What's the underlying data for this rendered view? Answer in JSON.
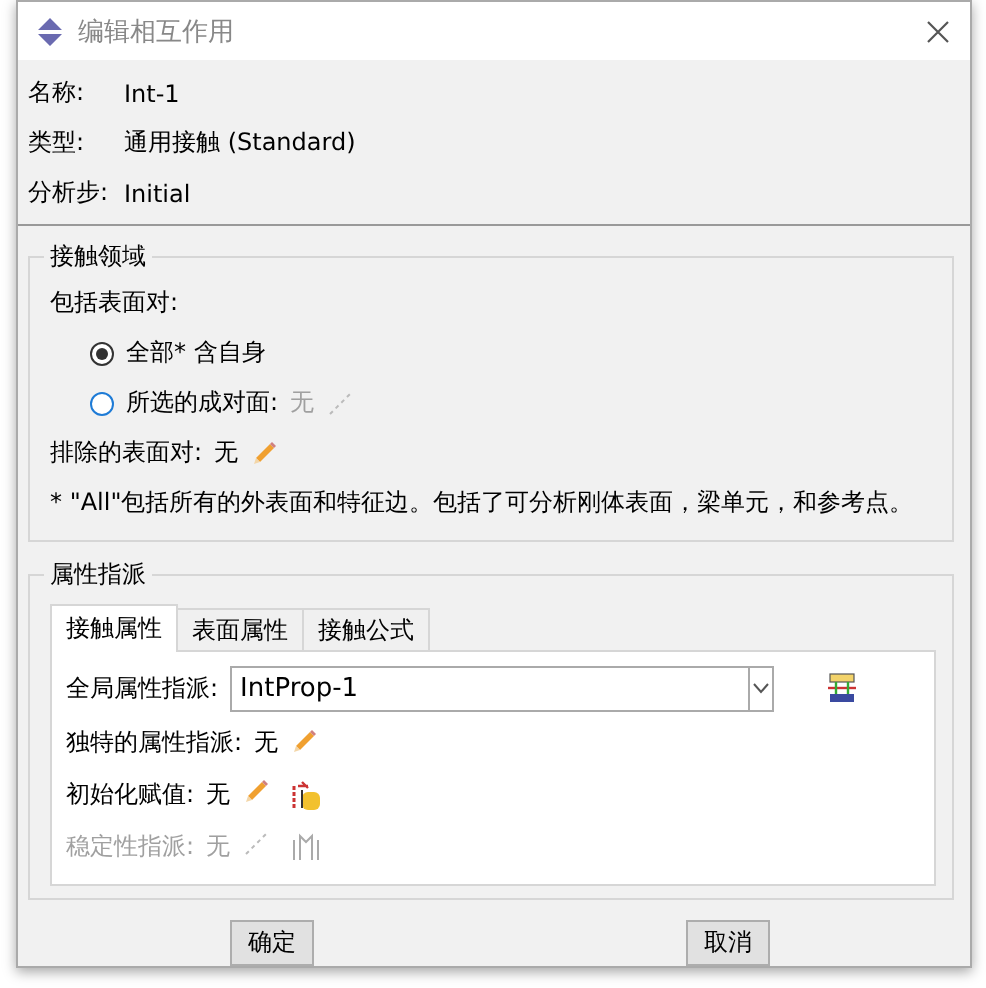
{
  "window": {
    "title": "编辑相互作用"
  },
  "fields": [
    {
      "label": "名称:",
      "value": "Int-1"
    },
    {
      "label": "类型:",
      "value": "通用接触 (Standard)"
    },
    {
      "label": "分析步:",
      "value": "Initial"
    }
  ],
  "contact_region": {
    "title": "接触领域",
    "include_label": "包括表面对:",
    "options": [
      {
        "label": "全部* 含自身",
        "selected": true
      },
      {
        "label": "所选的成对面:",
        "selected": false,
        "value": "无"
      }
    ],
    "exclude": {
      "label": "排除的表面对:",
      "value": "无"
    },
    "note": "* \"All\"包括所有的外表面和特征边。包括了可分析刚体表面，梁单元，和参考点。"
  },
  "assignment": {
    "title": "属性指派",
    "tabs": [
      {
        "label": "接触属性",
        "selected": true
      },
      {
        "label": "表面属性",
        "selected": false
      },
      {
        "label": "接触公式",
        "selected": false
      }
    ],
    "global": {
      "label": "全局属性指派:",
      "value": "IntProp-1"
    },
    "rows": [
      {
        "kind": "plain",
        "label": "独特的属性指派:",
        "value": "无",
        "disabled": false
      },
      {
        "kind": "init",
        "label": "初始化赋值:",
        "value": "无",
        "disabled": false
      },
      {
        "kind": "stabilize",
        "label": "稳定性指派:",
        "value": "无",
        "disabled": true
      }
    ]
  },
  "buttons": [
    "确定",
    "取消"
  ]
}
